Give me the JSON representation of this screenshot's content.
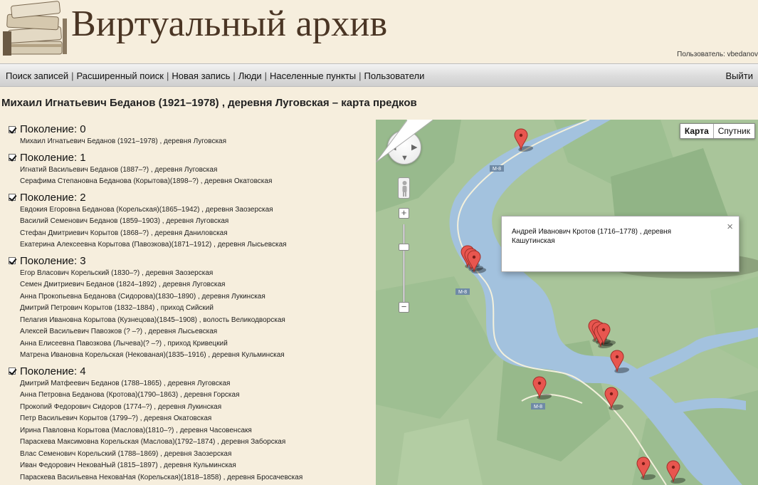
{
  "header": {
    "site_title": "Виртуальный архив",
    "user_label": "Пользователь:",
    "username": "vbedanov"
  },
  "nav": {
    "items": [
      {
        "label": "Поиск записей"
      },
      {
        "label": "Расширенный поиск"
      },
      {
        "label": "Новая запись"
      },
      {
        "label": "Люди"
      },
      {
        "label": "Населенные пункты"
      },
      {
        "label": "Пользователи"
      }
    ],
    "separator": "|",
    "logout": "Выйти"
  },
  "page": {
    "title": "Михаил Игнатьевич Беданов (1921–1978) , деревня Луговская – карта предков"
  },
  "generations": [
    {
      "label": "Поколение: 0",
      "checked": true,
      "people": [
        "Михаил Игнатьевич Беданов (1921–1978) , деревня Луговская"
      ]
    },
    {
      "label": "Поколение: 1",
      "checked": true,
      "people": [
        "Игнатий Васильевич Беданов (1887–?) , деревня Луговская",
        "Серафима Степановна Беданова (Корытова)(1898–?) , деревня Окатовская"
      ]
    },
    {
      "label": "Поколение: 2",
      "checked": true,
      "people": [
        "Евдокия Егоровна Беданова (Корельская)(1865–1942) , деревня Заозерская",
        "Василий Семенович Беданов (1859–1903) , деревня Луговская",
        "Стефан Дмитриевич Корытов (1868–?) , деревня Даниловская",
        "Екатерина Алексеевна Корытова (Павозкова)(1871–1912) , деревня Лысьевская"
      ]
    },
    {
      "label": "Поколение: 3",
      "checked": true,
      "people": [
        "Егор Власович Корельский (1830–?) , деревня Заозерская",
        "Семен Дмитриевич Беданов (1824–1892) , деревня Луговская",
        "Анна Прокопьевна Беданова (Сидорова)(1830–1890) , деревня Лукинская",
        "Дмитрий Петрович Корытов (1832–1884) , приход Сийский",
        "Пелагия Ивановна Корытова (Кузнецова)(1845–1908) , волость Великодворская",
        "Алексей Васильевич Павозков (? –?) , деревня Лысьевская",
        "Анна Елисеевна Павозкова (Лычева)(? –?) , приход Кривецкий",
        "Матрена Ивановна Корельская (Некованая)(1835–1916) , деревня Кульминская"
      ]
    },
    {
      "label": "Поколение: 4",
      "checked": true,
      "people": [
        "Дмитрий Матфеевич Беданов (1788–1865) , деревня Луговская",
        "Анна Петровна Беданова (Кротова)(1790–1863) , деревня Горская",
        "Прокопий Федорович Сидоров (1774–?) , деревня Лукинская",
        "Петр Васильевич Корытов (1799–?) , деревня Окатовская",
        "Ирина Павловна Корытова (Маслова)(1810–?) , деревня Часовенсакя",
        "Параскева Максимовна Корельская (Маслова)(1792–1874) , деревня Заборская",
        "Влас Семенович Корельский (1788–1869) , деревня Заозерская",
        "Иван Федорович НековаНый (1815–1897) , деревня Кульминская",
        "Параскева Васильевна НековаНая (Корельская)(1818–1858) , деревня Бросачевская"
      ]
    }
  ],
  "map": {
    "type_buttons": [
      {
        "label": "Карта",
        "active": true
      },
      {
        "label": "Спутник",
        "active": false
      }
    ],
    "road_label": "M-8",
    "infowindow": {
      "text": "Андрей Иванович Кротов (1716–1778) , деревня Кашутинская",
      "close": "×"
    },
    "colors": {
      "land": "#a9c59a",
      "forest": "#94b789",
      "river": "#a3c2de",
      "marker": "#e8564f"
    }
  }
}
